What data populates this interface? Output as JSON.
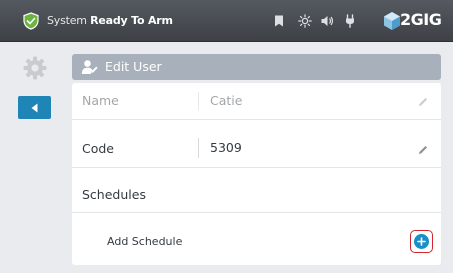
{
  "header": {
    "status_prefix": "System",
    "status_bold": "Ready To Arm",
    "brand": "2GIG",
    "icons": [
      "shield-check-icon",
      "bookmark-icon",
      "sun-icon",
      "volume-icon",
      "plug-icon"
    ]
  },
  "nav": {
    "settings_icon": "gear-icon",
    "back_icon": "back-arrow-icon"
  },
  "titlebar": {
    "icon": "user-edit-icon",
    "title": "Edit User"
  },
  "form": {
    "name_label": "Name",
    "name_value": "Catie",
    "code_label": "Code",
    "code_value": "5309",
    "schedules_heading": "Schedules",
    "add_schedule_label": "Add Schedule"
  },
  "colors": {
    "header_bg": "#45494e",
    "shield_green": "#6cb33f",
    "back_blue": "#1f84b6",
    "titlebar_bg": "#a7b0bb",
    "add_blue": "#1a8fc7",
    "highlight_red": "#d4252c"
  }
}
